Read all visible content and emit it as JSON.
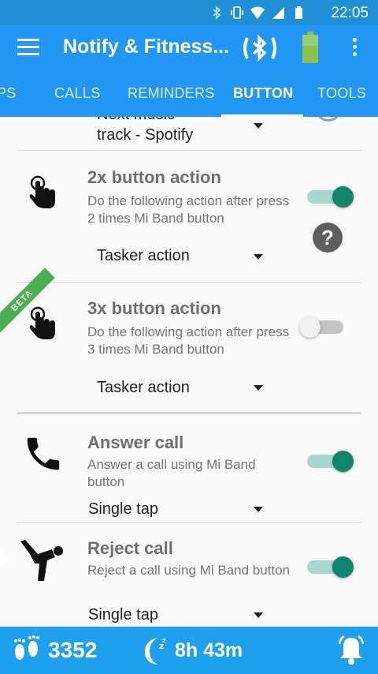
{
  "status_bar": {
    "time": "22:05",
    "icons": [
      "bluetooth-icon",
      "vibrate-icon",
      "wifi-icon",
      "signal-icon",
      "battery-icon"
    ]
  },
  "app_bar": {
    "title": "Notify & Fitness...",
    "icons": [
      "menu-icon",
      "bluetooth-sync-icon",
      "band-battery-icon",
      "overflow-menu-icon"
    ]
  },
  "tabs": [
    {
      "label": "PS"
    },
    {
      "label": "CALLS"
    },
    {
      "label": "REMINDERS"
    },
    {
      "label": "BUTTON",
      "active": true
    },
    {
      "label": "TOOLS"
    }
  ],
  "rows": [
    {
      "title": "",
      "dropdown_line1": "Next music",
      "dropdown_line2": "track - Spotify"
    },
    {
      "icon": "double-tap-icon",
      "title": "2x button action",
      "desc": "Do the following action after press 2 times Mi Band button",
      "toggle": true,
      "dropdown": "Tasker action",
      "help_glyph": "?"
    },
    {
      "icon": "triple-tap-icon",
      "badge": "BETA",
      "title": "3x button action",
      "desc": "Do the following action after press 3 times Mi Band button",
      "toggle": false,
      "dropdown": "Tasker action"
    },
    {
      "icon": "phone-icon",
      "title": "Answer call",
      "desc": "Answer a call using Mi Band button",
      "toggle": true,
      "dropdown": "Single tap"
    },
    {
      "icon": "karate-kick-icon",
      "title": "Reject call",
      "desc": "Reject a call using Mi Band button",
      "toggle": true,
      "dropdown": "Single tap"
    }
  ],
  "bottom_bar": {
    "steps": "3352",
    "sleep": "8h 43m",
    "icons": [
      "footsteps-icon",
      "sleep-moon-icon",
      "alarm-bell-icon"
    ]
  },
  "colors": {
    "status_bar": "#1f8fd8",
    "app_bar": "#2196f3",
    "bottom_bar": "#1fa0ee",
    "toggle_on": "#12836d",
    "beta_badge": "#4caf50"
  }
}
